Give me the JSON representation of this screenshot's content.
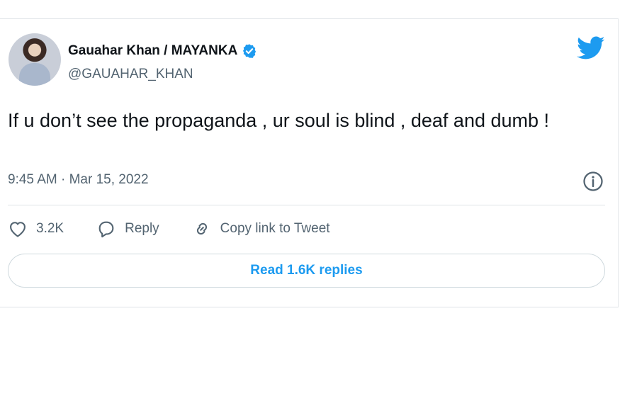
{
  "tweet": {
    "author_name": "Gauahar Khan / MAYANKA",
    "handle": "@GAUAHAR_KHAN",
    "text": "If u don’t see the propaganda , ur soul is blind , deaf and dumb !",
    "timestamp": "9:45 AM · Mar 15, 2022",
    "likes": "3.2K",
    "reply_label": "Reply",
    "copy_link_label": "Copy link to Tweet",
    "read_replies_label": "Read 1.6K replies"
  },
  "icons": {
    "brand": "twitter-bird-icon",
    "verified": "verified-badge-icon",
    "info": "info-icon",
    "like": "heart-icon",
    "reply": "reply-bubble-icon",
    "link": "link-icon"
  },
  "colors": {
    "brand_blue": "#1d9bf0",
    "text_primary": "#0f1419",
    "text_secondary": "#536471",
    "border": "#cfd9de"
  }
}
